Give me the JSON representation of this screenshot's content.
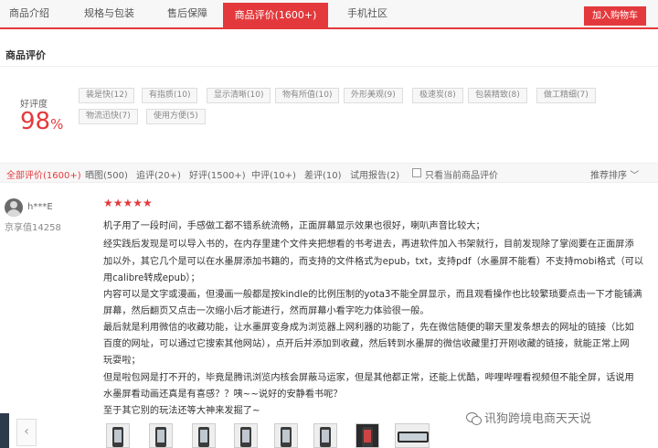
{
  "tabs": [
    {
      "label": "商品介绍"
    },
    {
      "label": "规格与包装"
    },
    {
      "label": "售后保障"
    },
    {
      "label": "商品评价(1600+)"
    },
    {
      "label": "手机社区"
    }
  ],
  "add_to_cart": "加入购物车",
  "section_title": "商品评价",
  "rating": {
    "label": "好评度",
    "value": "98",
    "unit": "%"
  },
  "tags": [
    "装是快(12)",
    "有指质(10)",
    "显示清晰(10)",
    "物有所值(10)",
    "外形美观(9)",
    "极速炭(8)",
    "包装精致(8)",
    "做工精细(7)",
    "物流迅快(7)",
    "使用方便(5)"
  ],
  "filters": [
    "全部评价(1600+)",
    "晒图(500)",
    "追评(20+)",
    "好评(1500+)",
    "中评(10+)",
    "差评(10)",
    "试用报告(2)",
    "只看当前商品评价"
  ],
  "sort_label": "推荐排序",
  "review": {
    "username": "h***E",
    "level": "京享值14258",
    "stars": "★★★★★",
    "lines": [
      "机子用了一段时间，手感做工都不错系统流畅，正面屏幕显示效果也很好，喇叭声音比较大；",
      "经实践后发现是可以导入书的，在内存里建个文件夹把想看的书考进去，再进软件加入书架就行，目前发现除了掌阅要在正面屏添",
      "加以外，其它几个是可以在水墨屏添加书籍的，而支持的文件格式为epub，txt，支持pdf（水墨屏不能看）不支持mobi格式（可以",
      "用calibre转成epub）；",
      "内容可以是文字或漫画，但漫画一般都是按kindle的比例压制的yota3不能全屏显示，而且观看操作也比较繁琐要点击一下才能铺满",
      "屏幕，然后翻页又点击一次缩小后才能进行，然而屏幕小看字吃力体验很一般。",
      "最后就是利用微信的收藏功能，让水墨屏变身成为浏览器上网利器的功能了，先在微信随便的聊天里发条想去的网址的链接（比如",
      "百度的网址，可以通过它搜索其他网站），点开后并添加到收藏，然后转到水墨屏的微信收藏里打开刚收藏的链接，就能正常上网",
      "玩耍啦；",
      "但是啦包网是打不开的，毕竟是腾讯浏览内核会屏蔽马运家，但是其他都正常，还能上优酷，哔哩哔哩看视频但不能全屏，话说用",
      "水墨屏看动画还真是有喜感？？咦~~说好的安静看书呢？",
      "至于其它别的玩法还等大神来发掘了~"
    ]
  },
  "watermark": "讯狗跨境电商天天说"
}
